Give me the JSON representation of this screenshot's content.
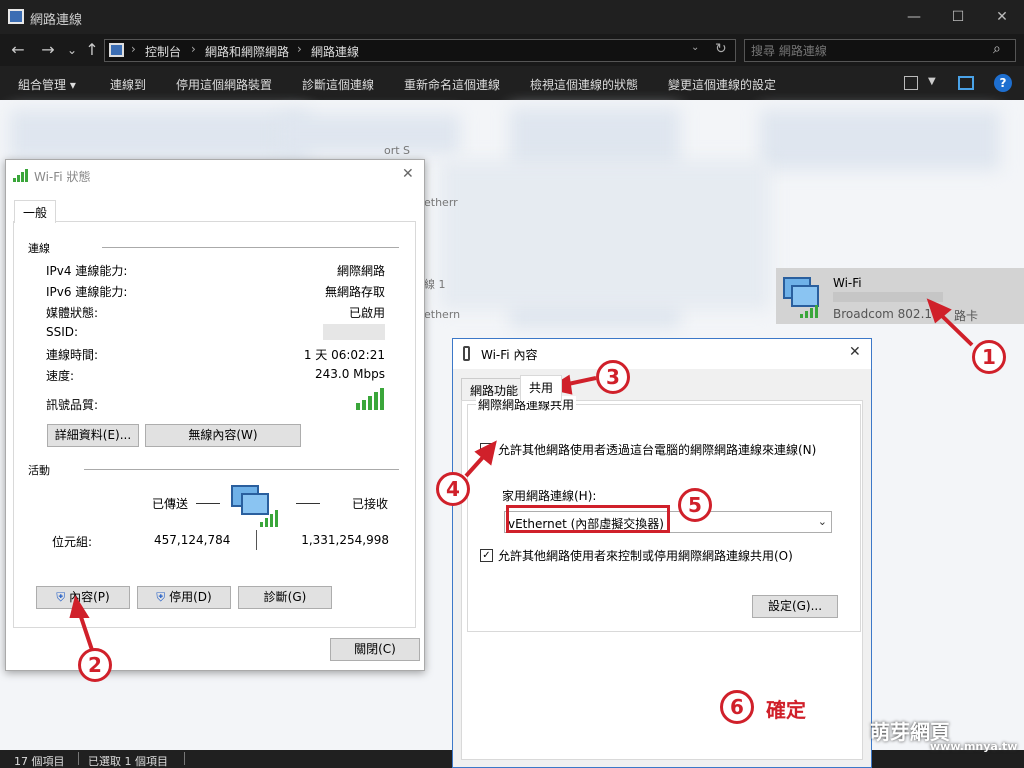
{
  "window": {
    "title": "網路連線",
    "minimize": "—",
    "maximize": "☐",
    "close": "✕"
  },
  "nav": {
    "back": "←",
    "forward": "→",
    "recent": "⌄",
    "up": "↑",
    "breadcrumbs": [
      "控制台",
      "網路和網際網路",
      "網路連線"
    ],
    "refresh": "↻",
    "search_placeholder": "搜尋 網路連線",
    "search_icon": "⌕"
  },
  "commands": [
    "組合管理 ▾",
    "連線到",
    "停用這個網路裝置",
    "診斷這個連線",
    "重新命名這個連線",
    "檢視這個連線的狀態",
    "變更這個連線的設定"
  ],
  "cmd_help": "?",
  "adapter": {
    "name": "Wi-Fi",
    "description": "Broadcom 802.11",
    "description_tail": "路卡"
  },
  "partial_texts": [
    "ort S",
    "etherr",
    "線 1",
    "ethern"
  ],
  "status_bar": {
    "items": "17 個項目",
    "selected": "已選取 1 個項目"
  },
  "status_dialog": {
    "title": "Wi-Fi 狀態",
    "close": "✕",
    "tab": "一般",
    "connection_group": "連線",
    "rows": [
      {
        "label": "IPv4 連線能力:",
        "value": "網際網路"
      },
      {
        "label": "IPv6 連線能力:",
        "value": "無網路存取"
      },
      {
        "label": "媒體狀態:",
        "value": "已啟用"
      },
      {
        "label": "SSID:",
        "value": ""
      },
      {
        "label": "連線時間:",
        "value": "1 天 06:02:21"
      },
      {
        "label": "速度:",
        "value": "243.0 Mbps"
      }
    ],
    "signal_label": "訊號品質:",
    "details_button": "詳細資料(E)...",
    "wireless_button": "無線內容(W)",
    "activity_group": "活動",
    "sent_label": "已傳送",
    "received_label": "已接收",
    "bytes_label": "位元組:",
    "bytes_sent": "457,124,784",
    "bytes_received": "1,331,254,998",
    "properties_button": "內容(P)",
    "disable_button": "停用(D)",
    "diagnose_button": "診斷(G)",
    "close_button": "關閉(C)"
  },
  "props_dialog": {
    "title": "Wi-Fi 內容",
    "close": "✕",
    "tab_networking": "網路功能",
    "tab_sharing": "共用",
    "group": "網際網路連線共用",
    "allow_connect": "允許其他網路使用者透過這台電腦的網際網路連線來連線(N)",
    "home_network_label": "家用網路連線(H):",
    "home_network_value": "vEthernet (內部虛擬交換器)",
    "allow_control": "允許其他網路使用者來控制或停用網際網路連線共用(O)",
    "settings_button": "設定(G)...",
    "checked_mark": "✓"
  },
  "annotations": {
    "step1": "1",
    "step2": "2",
    "step3": "3",
    "step4": "4",
    "step5": "5",
    "step6": "6",
    "confirm": "確定"
  },
  "watermark": {
    "main": "萌芽網頁",
    "sub": "www.mnya.tw"
  },
  "colors": {
    "accent": "#0078d7",
    "annotation": "#d0202a",
    "signal": "#3aa63a"
  }
}
